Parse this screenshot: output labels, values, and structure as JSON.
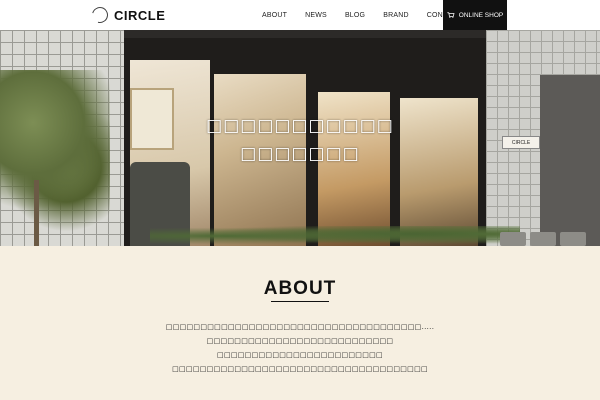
{
  "header": {
    "logo": "CIRCLE",
    "nav": [
      "ABOUT",
      "NEWS",
      "BLOG",
      "BRAND",
      "CONTACT"
    ],
    "shop_label": "ONLINE SHOP"
  },
  "hero": {
    "caption_lines": [
      "□□□□□□□□□□□",
      "□□□□□□□"
    ],
    "sign_text": "CIRCLE"
  },
  "about": {
    "title": "ABOUT",
    "lines": [
      "□□□□□□□□□□□□□□□□□□□□□□□□□□□□□□□□□□□□□.....",
      "□□□□□□□□□□□□□□□□□□□□□□□□□□□",
      "□□□□□□□□□□□□□□□□□□□□□□□□",
      "□□□□□□□□□□□□□□□□□□□□□□□□□□□□□□□□□□□□□"
    ]
  },
  "colors": {
    "header_bg": "#ffffff",
    "shop_button_bg": "#111111",
    "section_bg": "#f6efe1"
  }
}
